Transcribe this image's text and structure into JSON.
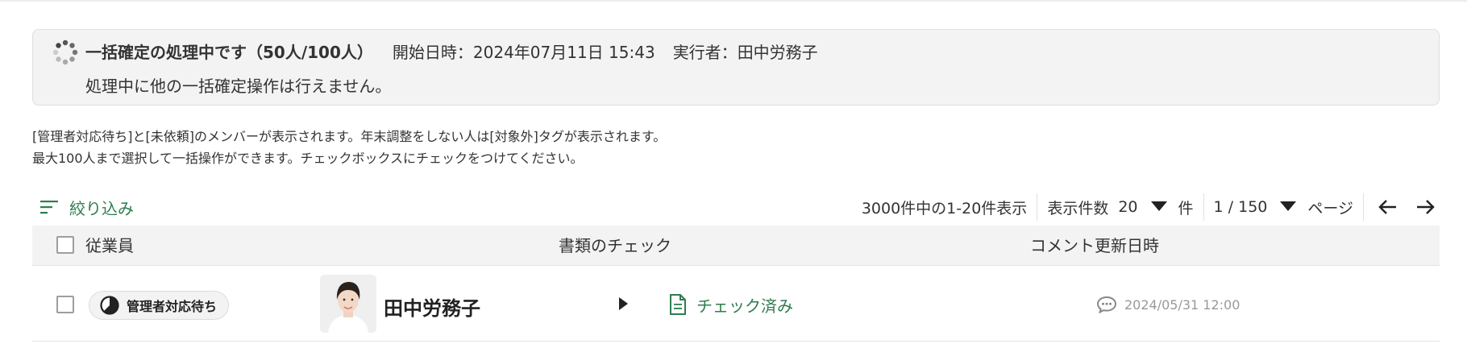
{
  "banner": {
    "title": "一括確定の処理中です（50人/100人）",
    "start_label": "開始日時：",
    "start_value": "2024年07月11日 15:43",
    "executor_label": "実行者：",
    "executor_value": "田中労務子",
    "note": "処理中に他の一括確定操作は行えません。"
  },
  "description": {
    "line1": "[管理者対応待ち]と[未依頼]のメンバーが表示されます。年末調整をしない人は[対象外]タグが表示されます。",
    "line2": "最大100人まで選択して一括操作ができます。チェックボックスにチェックをつけてください。"
  },
  "toolbar": {
    "filter_label": "絞り込み",
    "range_text": "3000件中の1-20件表示",
    "page_size_label": "表示件数",
    "page_size_value": "20",
    "page_size_unit": "件",
    "page_value": "1 / 150",
    "page_unit": "ページ"
  },
  "table": {
    "headers": [
      "従業員",
      "書類のチェック",
      "コメント更新日時"
    ],
    "rows": [
      {
        "status": "管理者対応待ち",
        "name": "田中労務子",
        "doc_status": "チェック済み",
        "comment_updated": "2024/05/31 12:00"
      }
    ]
  },
  "colors": {
    "accent_green": "#2e7d4f",
    "banner_bg": "#f3f3f3",
    "muted_text": "#999999"
  }
}
